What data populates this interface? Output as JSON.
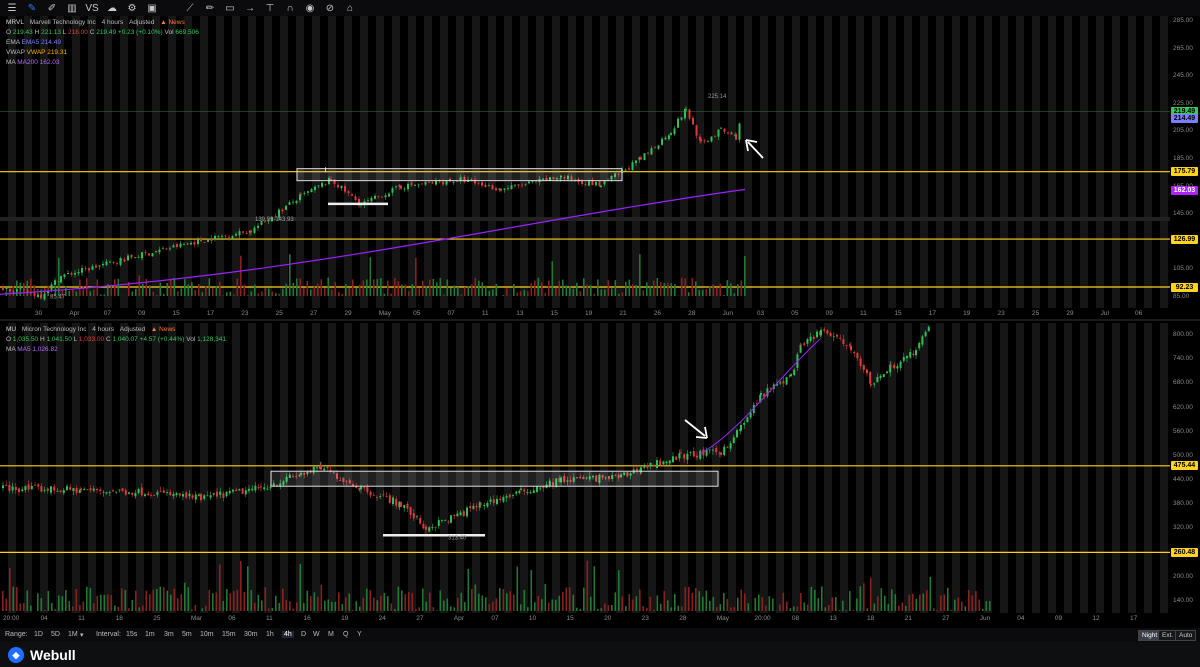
{
  "toolbar": {
    "icons": [
      "select-icon",
      "crosshair-icon",
      "draw-icon",
      "bar-type-icon",
      "compare-icon",
      "cloud-icon",
      "settings-icon",
      "indicator-icon",
      "templates-icon",
      "trendline-icon",
      "brush-icon",
      "shapes-icon",
      "arrow-icon",
      "text-icon",
      "magnet-icon",
      "eye-icon",
      "measure-icon",
      "lock-icon"
    ],
    "compare_label": "VS"
  },
  "top_chart": {
    "symbol": "MRVL",
    "name": "Marvell Technology Inc",
    "interval": "4 hours",
    "adjusted": "Adjusted",
    "news": "News",
    "ohlc": {
      "o_label": "O",
      "o": "219.43",
      "h_label": "H",
      "h": "221.13",
      "l_label": "L",
      "l": "218.00",
      "c_label": "C",
      "c": "219.49",
      "change": "+0.23 (+0.10%)",
      "vol_label": "Vol",
      "vol": "669,506"
    },
    "ema": {
      "label": "EMA",
      "value": "EMA5 214.49"
    },
    "vwap": {
      "label": "VWAP",
      "value": "VWAP 219.31"
    },
    "ma": {
      "label": "MA",
      "value": "MA200 162.03"
    },
    "price_ticks": [
      "285.00",
      "265.00",
      "245.00",
      "225.00",
      "205.00",
      "185.00",
      "165.00",
      "145.00",
      "125.00",
      "105.00",
      "85.00"
    ],
    "tags": [
      {
        "text": "219.49",
        "bg": "#35c95a",
        "fg": "#000"
      },
      {
        "text": "214.49",
        "bg": "#7a7dff",
        "fg": "#000"
      },
      {
        "text": "175.79",
        "bg": "#ffd21f",
        "fg": "#000"
      },
      {
        "text": "162.03",
        "bg": "#b020ff",
        "fg": "#fff"
      },
      {
        "text": "126.99",
        "bg": "#ffd21f",
        "fg": "#000"
      },
      {
        "text": "92.23",
        "bg": "#ffd21f",
        "fg": "#000"
      }
    ],
    "annotations": {
      "range_low": "139.99-143.93",
      "peak": "225.14",
      "low": "85.47"
    },
    "time_labels": [
      "30",
      "Apr",
      "07",
      "09",
      "15",
      "17",
      "23",
      "25",
      "27",
      "29",
      "May",
      "05",
      "07",
      "11",
      "13",
      "15",
      "19",
      "21",
      "26",
      "28",
      "Jun",
      "03",
      "05",
      "09",
      "11",
      "15",
      "17",
      "19",
      "23",
      "25",
      "29",
      "Jul",
      "06"
    ]
  },
  "bottom_chart": {
    "symbol": "MU",
    "name": "Micron Technology Inc",
    "interval": "4 hours",
    "adjusted": "Adjusted",
    "news": "News",
    "ohlc": {
      "o_label": "O",
      "o": "1,035.50",
      "h_label": "H",
      "h": "1,041.50",
      "l_label": "L",
      "l": "1,033.00",
      "c_label": "C",
      "c": "1,040.07",
      "change": "+4.57 (+0.44%)",
      "vol_label": "Vol",
      "vol": "1,128,341"
    },
    "ma": {
      "label": "MA",
      "value": "MA5 1,026.82"
    },
    "price_ticks": [
      "800.00",
      "740.00",
      "680.00",
      "620.00",
      "560.00",
      "500.00",
      "440.00",
      "380.00",
      "320.00",
      "260.00",
      "200.00",
      "140.00"
    ],
    "tags": [
      {
        "text": "475.44",
        "bg": "#ffd21f",
        "fg": "#000"
      },
      {
        "text": "260.48",
        "bg": "#ffd21f",
        "fg": "#000"
      }
    ],
    "annotations": {
      "low": "313.40"
    },
    "time_labels": [
      "20:00",
      "04",
      "11",
      "18",
      "25",
      "Mar",
      "06",
      "11",
      "16",
      "19",
      "24",
      "27",
      "Apr",
      "07",
      "10",
      "15",
      "20",
      "23",
      "28",
      "May",
      "20:00",
      "08",
      "13",
      "18",
      "21",
      "27",
      "Jun",
      "04",
      "09",
      "12",
      "17"
    ]
  },
  "range_bar": {
    "label": "Range:",
    "ranges": [
      "1D",
      "5D",
      "1M"
    ],
    "interval_label": "Interval:",
    "intervals": [
      "15s",
      "1m",
      "3m",
      "5m",
      "10m",
      "15m",
      "30m",
      "1h",
      "4h",
      "D",
      "W",
      "M",
      "Q",
      "Y"
    ],
    "selected_interval": "4h",
    "modes": [
      "Night",
      "Ext.",
      "Auto"
    ]
  },
  "brand": {
    "name": "Webull"
  }
}
